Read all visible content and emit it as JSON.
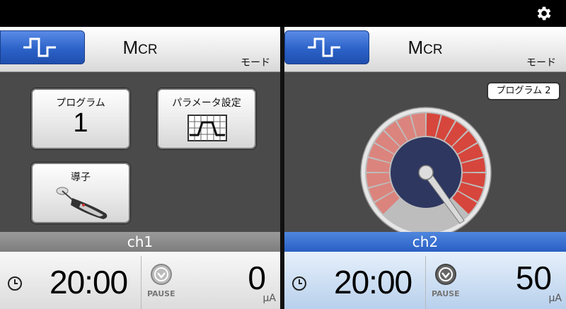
{
  "topbar": {
    "settings_icon": "gear-icon"
  },
  "ch1": {
    "mode": {
      "icon": "square-wave-icon",
      "title_big": "M",
      "title_small": "CR",
      "subtitle": "モード"
    },
    "tiles": {
      "program": {
        "label": "プログラム",
        "value": "1"
      },
      "param": {
        "label": "パラメータ設定",
        "icon": "parameter-table-icon"
      },
      "probe": {
        "label": "導子",
        "icon": "probe-icon"
      }
    },
    "channel_label": "ch1",
    "timer": "20:00",
    "pause_label": "PAUSE",
    "current": "0",
    "unit": "μA"
  },
  "ch2": {
    "mode": {
      "icon": "square-wave-icon",
      "title_big": "M",
      "title_small": "CR",
      "subtitle": "モード"
    },
    "program_badge": "プログラム 2",
    "gauge_level": 0.5,
    "channel_label": "ch2",
    "timer": "20:00",
    "pause_label": "PAUSE",
    "current": "50",
    "unit": "μA"
  },
  "colors": {
    "accent_blue": "#2c62c8",
    "gauge_red": "#d6463c",
    "gauge_dark": "#2e3760"
  }
}
